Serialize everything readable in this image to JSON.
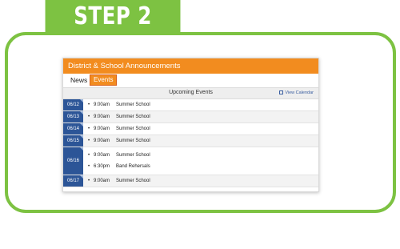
{
  "step_label": "STEP 2",
  "widget": {
    "title": "District & School Announcements",
    "tabs": {
      "news": "News",
      "events": "Events"
    },
    "list_title": "Upcoming Events",
    "view_calendar": "View Calendar"
  },
  "days": [
    {
      "date": "06/12",
      "events": [
        {
          "time": "9:00am",
          "name": "Summer School"
        }
      ]
    },
    {
      "date": "06/13",
      "events": [
        {
          "time": "9:00am",
          "name": "Summer School"
        }
      ]
    },
    {
      "date": "06/14",
      "events": [
        {
          "time": "9:00am",
          "name": "Summer School"
        }
      ]
    },
    {
      "date": "06/15",
      "events": [
        {
          "time": "9:00am",
          "name": "Summer School"
        }
      ]
    },
    {
      "date": "06/16",
      "events": [
        {
          "time": "9:00am",
          "name": "Summer School"
        },
        {
          "time": "6:30pm",
          "name": "Band Rehersals"
        }
      ]
    },
    {
      "date": "06/17",
      "events": [
        {
          "time": "9:00am",
          "name": "Summer School"
        }
      ]
    }
  ],
  "colors": {
    "green": "#7dc242",
    "orange": "#f28c1f",
    "date_blue": "#2c5597"
  }
}
